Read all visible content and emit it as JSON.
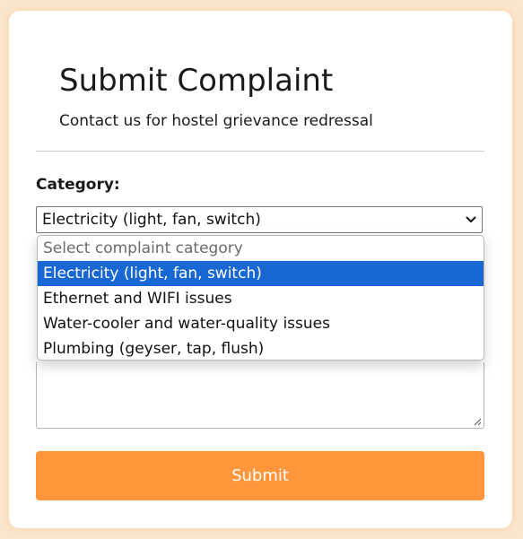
{
  "header": {
    "title": "Submit Complaint",
    "subtitle": "Contact us for hostel grievance redressal"
  },
  "form": {
    "category_label": "Category:",
    "category_selected": "Electricity (light, fan, switch)",
    "category_options": [
      "Select complaint category",
      "Electricity (light, fan, switch)",
      "Ethernet and WIFI issues",
      "Water-cooler and water-quality issues",
      "Plumbing (geyser, tap, flush)"
    ],
    "submit_label": "Submit"
  },
  "colors": {
    "background": "#fbe6cc",
    "accent": "#ff963b",
    "selection": "#1967d2"
  },
  "icons": {
    "select_arrow": "chevron-down-icon",
    "resize_handle": "resize-grip-icon"
  }
}
